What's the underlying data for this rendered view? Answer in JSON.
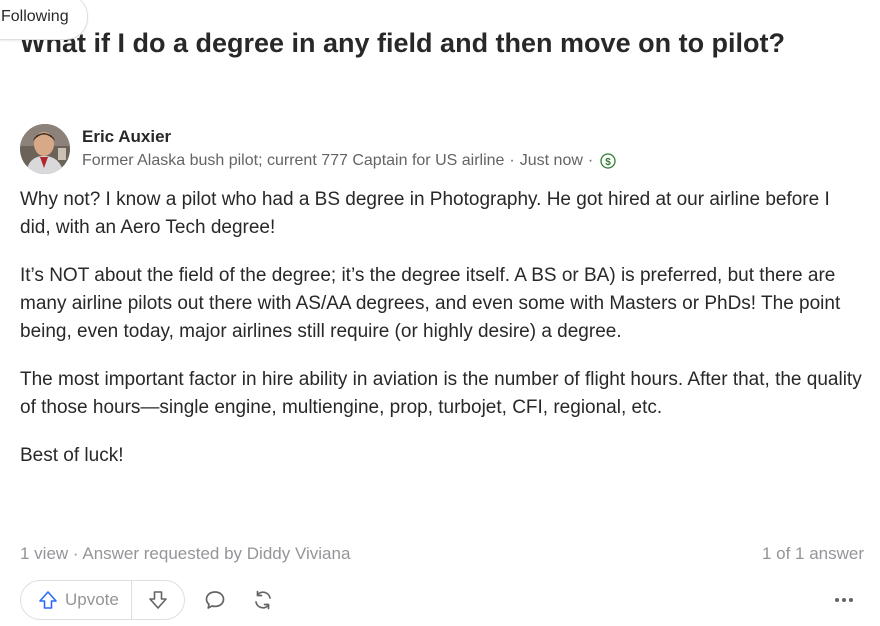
{
  "header": {
    "following_label": "Following"
  },
  "question": {
    "title": "What if I do a degree in any field and then move on to pilot?"
  },
  "author": {
    "name": "Eric Auxier",
    "credential": "Former Alaska bush pilot; current 777 Captain for US airline",
    "separator": "·",
    "timestamp": "Just now",
    "monetization_icon": "dollar-circle-icon",
    "monetization_color": "#2e7d32"
  },
  "answer": {
    "paragraphs": [
      "Why not? I know a pilot who had a BS degree in Photography. He got hired at our airline before I did, with an Aero Tech degree!",
      "It’s NOT about the field of the degree; it’s the degree itself. A BS or BA) is preferred, but there are many airline pilots out there with AS/AA degrees, and even some with Masters or PhDs! The point being, even today, major airlines still require (or highly desire) a degree.",
      "The most important factor in hire ability in aviation is the number of flight hours. After that, the quality of those hours—single engine, multiengine, prop, turbojet, CFI, regional, etc.",
      "Best of luck!"
    ]
  },
  "stats": {
    "views_text": "1 view · Answer requested by Diddy Viviana",
    "answer_count_text": "1 of 1 answer"
  },
  "actions": {
    "upvote_label": "Upvote",
    "upvote_icon": "arrow-up-icon",
    "downvote_icon": "arrow-down-icon",
    "comment_icon": "comment-icon",
    "share_icon": "share-icon",
    "more_icon": "more-horizontal-icon",
    "icon_color": "#636466",
    "upvote_color": "#2e69ff"
  }
}
